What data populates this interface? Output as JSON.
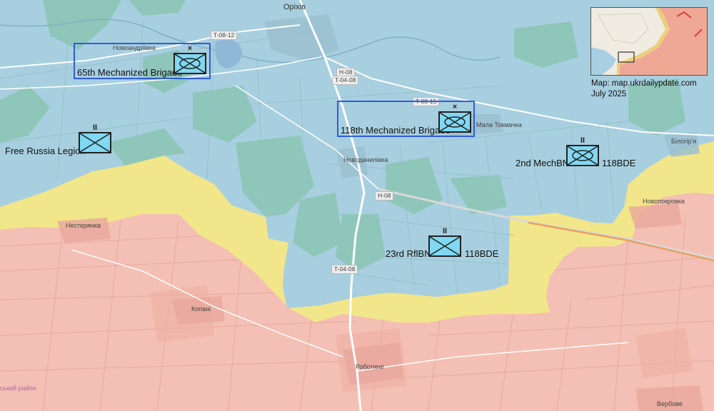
{
  "colors": {
    "ukraine_control": "#a8cfdf",
    "contested": "#f2e68a",
    "russia_control": "#f4bfb4",
    "unit_fill": "#80d8f2",
    "highlight_box": "#2f5be0",
    "highway": "#e8a060"
  },
  "places": {
    "orikhiv": "Оріхів",
    "novoandriivka": "Новоандріївка",
    "mala_tokmachka": "Мала Токмачка",
    "bilohirya": "Білогір'я",
    "novodanylivka": "Новоданилівка",
    "novopokrovka": "Новопокровка",
    "nesteryanka": "Нестерянка",
    "kopani": "Копані",
    "robotyne": "Роботине",
    "verbove": "Вербове",
    "district": "ський район"
  },
  "roads": {
    "t0812": "T-08-12",
    "h08_a": "H-08",
    "t0408_a": "T-04-08",
    "t0815": "T-08-15",
    "h08_b": "H-08",
    "t0408_b": "T-04-08"
  },
  "units": {
    "brigade_65": {
      "label": "65th Mechanized Brigade",
      "echelon": "×",
      "symbol": "mechanized"
    },
    "brigade_118": {
      "label": "118th Mechanized Brigade",
      "echelon": "×",
      "symbol": "mechanized"
    },
    "free_russia": {
      "label": "Free Russia Legion",
      "echelon": "II",
      "symbol": "infantry"
    },
    "mech_bn_2": {
      "label": "2nd MechBN",
      "echelon": "II",
      "symbol": "mechanized",
      "parent": "118BDE"
    },
    "rifle_bn_23": {
      "label": "23rd RflBN",
      "echelon": "II",
      "symbol": "infantry",
      "parent": "118BDE"
    }
  },
  "credit": {
    "source": "Map: map.ukrdailypdate.com",
    "date": "July 2025"
  }
}
